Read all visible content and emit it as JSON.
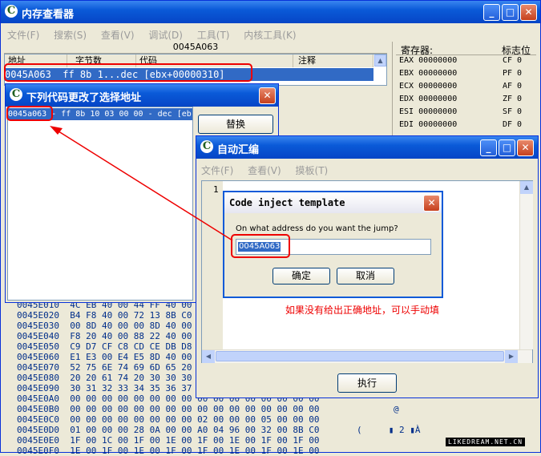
{
  "main": {
    "title": "内存查看器",
    "menu": [
      "文件(F)",
      "搜索(S)",
      "查看(V)",
      "调试(D)",
      "工具(T)",
      "内核工具(K)"
    ],
    "address_bar": "0045A063",
    "columns": [
      "地址",
      "字节数",
      "代码",
      "注释"
    ],
    "selected_line": "0045A063  ff 8b 1...dec [ebx+00000310]",
    "reg_header": "寄存器:",
    "flag_header": "标志位",
    "registers": [
      "EAX 00000000",
      "EBX 00000000",
      "ECX 00000000",
      "EDX 00000000",
      "ESI 00000000",
      "EDI 00000000"
    ],
    "flags": [
      "CF 0",
      "PF 0",
      "AF 0",
      "ZF 0",
      "SF 0",
      "DF 0"
    ],
    "hex_rows": [
      {
        "addr": "0045E010",
        "bytes": "4C EB 40 00 44 FF 40 00"
      },
      {
        "addr": "0045E020",
        "bytes": "B4 F8 40 00 72 13 8B C0"
      },
      {
        "addr": "0045E030",
        "bytes": "00 8D 40 00 00 8D 40 00"
      },
      {
        "addr": "0045E040",
        "bytes": "F8 20 40 00 88 22 40 00"
      },
      {
        "addr": "0045E050",
        "bytes": "C9 D7 CF C8 CD CE DB D8"
      },
      {
        "addr": "0045E060",
        "bytes": "E1 E3 00 E4 E5 8D 40 00"
      },
      {
        "addr": "0045E070",
        "bytes": "52 75 6E 74 69 6D 65 20"
      },
      {
        "addr": "0045E080",
        "bytes": "20 20 61 74 20 30 30 30"
      },
      {
        "addr": "0045E090",
        "bytes": "30 31 32 33 34 35 36 37"
      },
      {
        "addr": "0045E0A0",
        "bytes": "00 00 00 00 00 00 00 00 00 00 00 00 00 00 00 00"
      },
      {
        "addr": "0045E0B0",
        "bytes": "00 00 00 00 00 00 00 00 00 00 00 00 00 00 00 00"
      },
      {
        "addr": "0045E0C0",
        "bytes": "00 00 00 00 00 00 00 00 02 00 00 00 05 00 00 00"
      },
      {
        "addr": "0045E0D0",
        "bytes": "01 00 00 00 28 0A 00 00 A0 04 96 00 32 00 8B C0"
      },
      {
        "addr": "0045E0E0",
        "bytes": "1F 00 1C 00 1F 00 1E 00 1F 00 1E 00 1F 00 1F 00"
      },
      {
        "addr": "0045E0F0",
        "bytes": "1E 00 1F 00 1E 00 1F 00 1F 00 1E 00 1F 00 1E 00"
      }
    ],
    "ascii_b0": "@",
    "ascii_d0": "(     ▮ 2 ▮À"
  },
  "changed": {
    "title": "下列代码更改了选择地址",
    "item": "0045a063 - ff 8b 10 03 00 00 - dec [eb",
    "replace_button": "替换"
  },
  "autoasm": {
    "title": "自动汇编",
    "menu": [
      "文件(F)",
      "查看(V)",
      "摸板(T)"
    ],
    "line_number": "1",
    "execute_button": "执行"
  },
  "dialog": {
    "title": "Code inject template",
    "question": "On what address do you want the jump?",
    "value": "0045A063",
    "ok": "确定",
    "cancel": "取消"
  },
  "annotation": "如果没有给出正确地址，可以手动填",
  "watermark": "LIKEDREAM.NET.CN",
  "colors": {
    "accent": "#0a5ad8",
    "highlight": "#316ac5",
    "annotation": "#e00000"
  }
}
